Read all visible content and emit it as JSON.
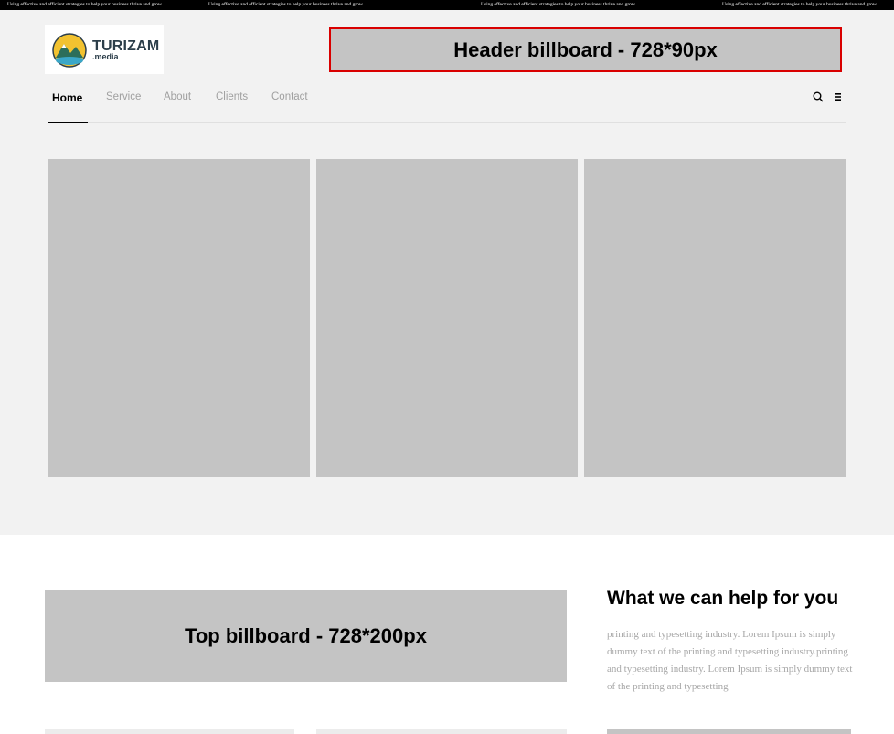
{
  "ticker": {
    "items": [
      "Using effective and efficient strategies to help your business thrive and grow",
      "Using effective and efficient strategies to help your business thrive and grow",
      "Using effective and efficient strategies to help your business thrive and grow",
      "Using effective and efficient strategies to help your business thrive and grow"
    ]
  },
  "logo": {
    "main": "TURIZAM",
    "sub": ".media"
  },
  "header_ad": {
    "label": "Header billboard - 728*90px"
  },
  "nav": {
    "items": [
      "Home",
      "Service",
      "About",
      "Clients",
      "Contact"
    ],
    "icons": [
      "search-icon",
      "menu-icon"
    ]
  },
  "top_ad": {
    "label": "Top billboard - 728*200px"
  },
  "sidebar": {
    "title": "What we can help for you",
    "text": "printing and typesetting industry. Lorem Ipsum is simply dummy text of the printing and typesetting industry.printing and typesetting industry. Lorem Ipsum is simply dummy text of the printing and typesetting"
  },
  "colors": {
    "accent_border": "#d90000",
    "placeholder": "#c4c4c4",
    "hero_bg": "#f2f2f2"
  }
}
